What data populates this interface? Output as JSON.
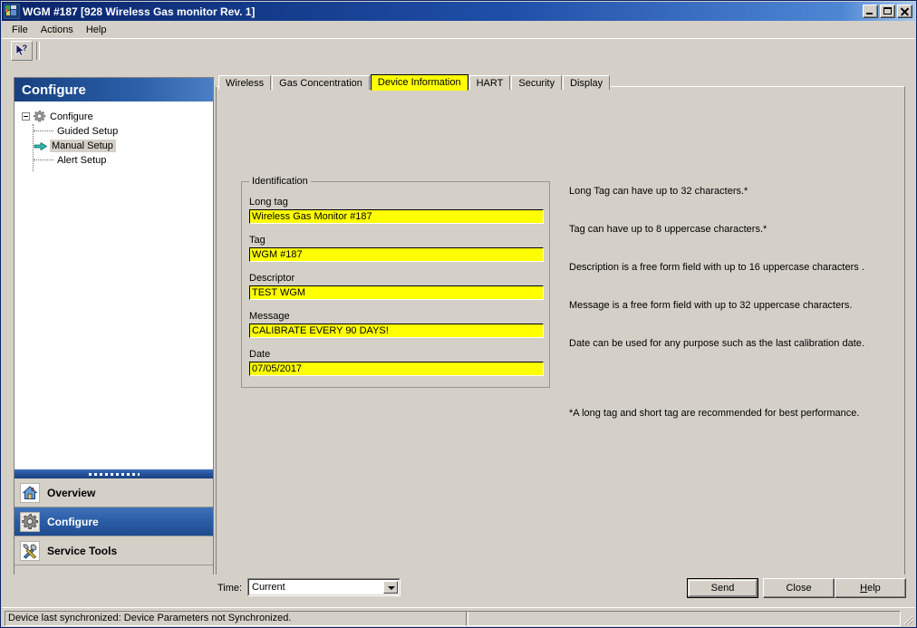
{
  "window": {
    "title": "WGM #187 [928 Wireless Gas monitor Rev. 1]",
    "icon": "app-icon",
    "minimize_label": "Minimize",
    "maximize_label": "Maximize",
    "close_label": "Close"
  },
  "menubar": {
    "items": [
      {
        "label": "File"
      },
      {
        "label": "Actions"
      },
      {
        "label": "Help"
      }
    ]
  },
  "toolbar": {
    "help_cursor_icon": "help-cursor-icon"
  },
  "sidebar": {
    "header": "Configure",
    "tree": {
      "root_label": "Configure",
      "root_icon": "gear-icon",
      "children": [
        {
          "label": "Guided Setup",
          "selected": false
        },
        {
          "label": "Manual Setup",
          "selected": true
        },
        {
          "label": "Alert Setup",
          "selected": false
        }
      ]
    },
    "nav_buttons": [
      {
        "label": "Overview",
        "icon": "home-icon",
        "selected": false
      },
      {
        "label": "Configure",
        "icon": "gear-icon",
        "selected": true
      },
      {
        "label": "Service Tools",
        "icon": "tools-icon",
        "selected": false
      }
    ]
  },
  "tabs": [
    {
      "label": "Wireless",
      "active": false
    },
    {
      "label": "Gas Concentration",
      "active": false
    },
    {
      "label": "Device Information",
      "active": true
    },
    {
      "label": "HART",
      "active": false
    },
    {
      "label": "Security",
      "active": false
    },
    {
      "label": "Display",
      "active": false
    }
  ],
  "identification": {
    "legend": "Identification",
    "fields": [
      {
        "label": "Long tag",
        "value": "Wireless Gas Monitor #187"
      },
      {
        "label": "Tag",
        "value": "WGM #187"
      },
      {
        "label": "Descriptor",
        "value": "TEST WGM"
      },
      {
        "label": "Message",
        "value": "CALIBRATE EVERY 90 DAYS!"
      },
      {
        "label": "Date",
        "value": "07/05/2017"
      }
    ]
  },
  "help_text": {
    "lines": [
      "Long Tag can have up to 32 characters.*",
      "Tag can have up to 8 uppercase characters.*",
      "Description is a free form field with up to 16 uppercase characters .",
      "Message is a free form field with up to 32 uppercase characters.",
      "Date can be used for any purpose such as the last calibration date."
    ],
    "footnote": "*A long tag and short tag are recommended for best performance."
  },
  "bottom_bar": {
    "time_label": "Time:",
    "time_value": "Current",
    "time_options": [
      "Current"
    ],
    "buttons": {
      "send": "Send",
      "close": "Close",
      "help_prefix": "H",
      "help_rest": "elp"
    }
  },
  "statusbar": {
    "message": "Device last synchronized: Device Parameters not Synchronized.",
    "secondary": ""
  },
  "colors": {
    "titlebar_blue": "#0a246a",
    "field_yellow": "#ffff00",
    "active_tab_yellow": "#ffff00",
    "face": "#d4d0c8",
    "nav_selected_blue": "#2a5ca5"
  }
}
